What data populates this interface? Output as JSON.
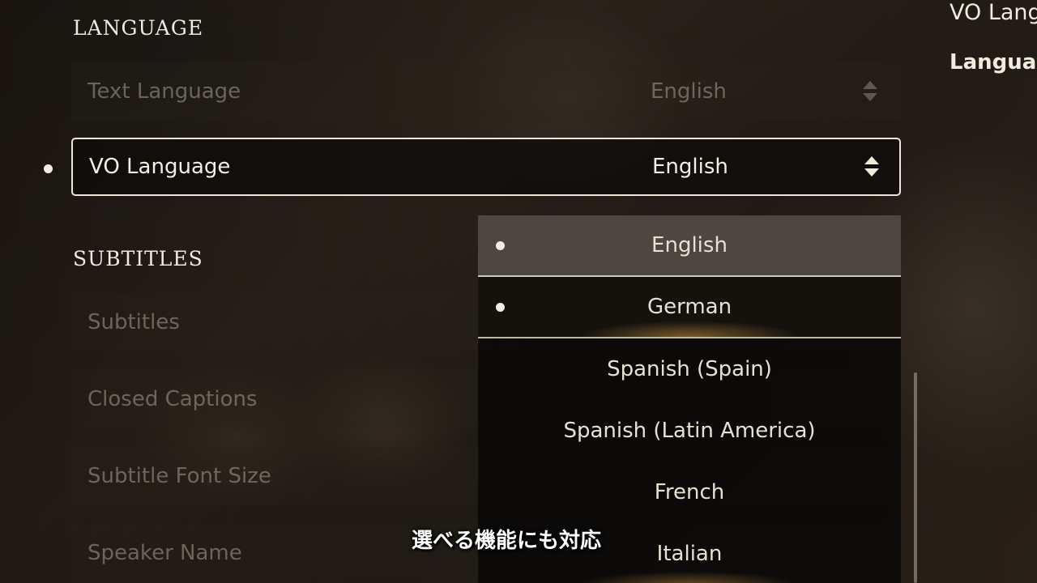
{
  "sections": {
    "language_title": "LANGUAGE",
    "subtitles_title": "SUBTITLES"
  },
  "language_rows": [
    {
      "label": "Text Language",
      "value": "English"
    },
    {
      "label": "VO Language",
      "value": "English"
    }
  ],
  "subtitle_rows": [
    {
      "label": "Subtitles"
    },
    {
      "label": "Closed Captions"
    },
    {
      "label": "Subtitle Font Size"
    },
    {
      "label": "Speaker Name"
    }
  ],
  "dropdown": {
    "options": [
      "English",
      "German",
      "Spanish (Spain)",
      "Spanish (Latin America)",
      "French",
      "Italian"
    ],
    "current": "English",
    "highlighted": "German"
  },
  "side_panel": {
    "title": "VO Lang",
    "subtitle": "Languag"
  },
  "caption": "選べる機能にも対応"
}
